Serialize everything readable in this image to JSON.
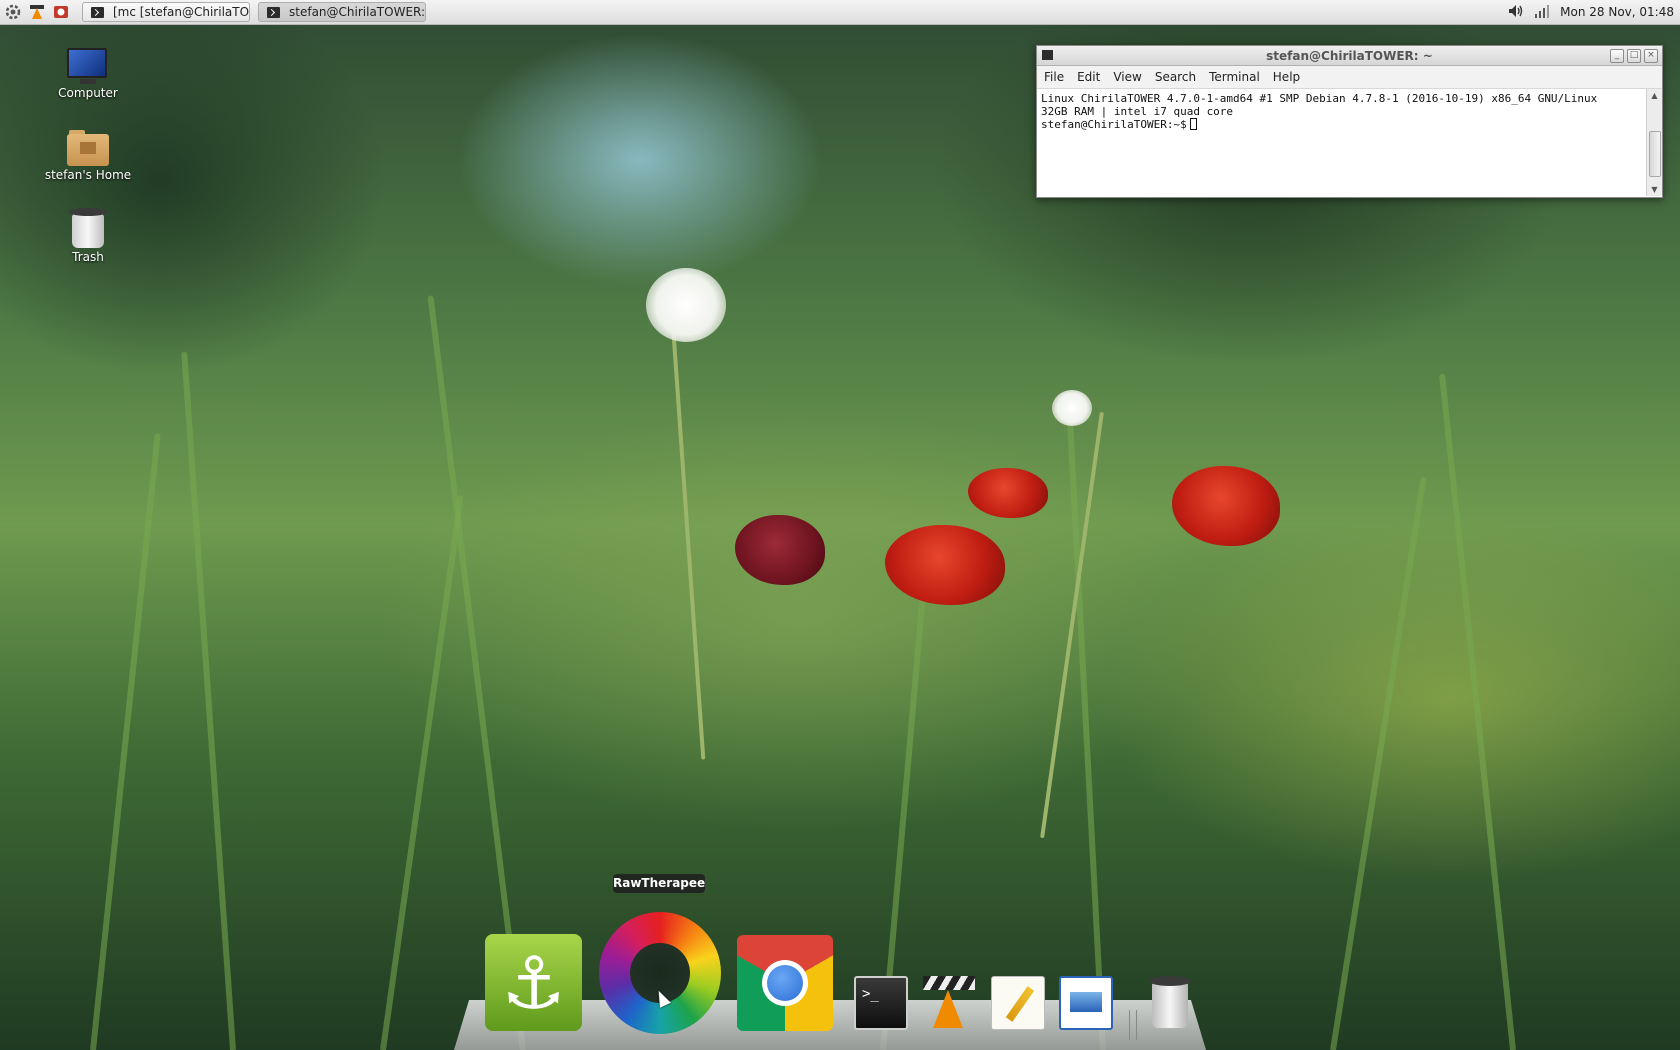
{
  "top_panel": {
    "launchers": [
      {
        "icon": "system-gear-icon",
        "color": "#555555"
      },
      {
        "icon": "vlc-launcher-icon",
        "color": "#f08a00"
      },
      {
        "icon": "screenshot-launcher-icon",
        "color": "#c0392b"
      }
    ],
    "tasks": [
      {
        "label": "[mc [stefan@ChirilaTO...",
        "active": false
      },
      {
        "label": "stefan@ChirilaTOWER:...",
        "active": true
      }
    ],
    "tray": {
      "volume_icon": "speaker-icon",
      "network_icon": "signal-bars-icon",
      "clock": "Mon 28 Nov, 01:48"
    }
  },
  "desktop_icons": [
    {
      "name": "computer",
      "label": "Computer"
    },
    {
      "name": "home",
      "label": "stefan's Home"
    },
    {
      "name": "trash",
      "label": "Trash"
    }
  ],
  "terminal": {
    "title": "stefan@ChirilaTOWER: ~",
    "menu": [
      "File",
      "Edit",
      "View",
      "Search",
      "Terminal",
      "Help"
    ],
    "lines": [
      "Linux ChirilaTOWER 4.7.0-1-amd64 #1 SMP Debian 4.7.8-1 (2016-10-19) x86_64 GNU/Linux",
      "32GB RAM | intel i7 quad core",
      "stefan@ChirilaTOWER:~$"
    ],
    "window_buttons": {
      "minimize": "_",
      "maximize": "□",
      "close": "×"
    }
  },
  "dock": {
    "tooltip": "RawTherapee",
    "items": [
      {
        "name": "anchor-app",
        "icon": "anchor-icon",
        "glyph": "⚓"
      },
      {
        "name": "rawtherapee",
        "icon": "color-wheel-icon"
      },
      {
        "name": "chrome",
        "icon": "chrome-icon"
      },
      {
        "name": "terminal",
        "icon": "terminal-icon",
        "glyph": ">_"
      },
      {
        "name": "vlc",
        "icon": "vlc-cone-icon"
      },
      {
        "name": "text-editor",
        "icon": "notepad-pencil-icon"
      },
      {
        "name": "image-viewer",
        "icon": "image-document-icon"
      },
      {
        "name": "trash",
        "icon": "trash-can-icon"
      }
    ]
  }
}
